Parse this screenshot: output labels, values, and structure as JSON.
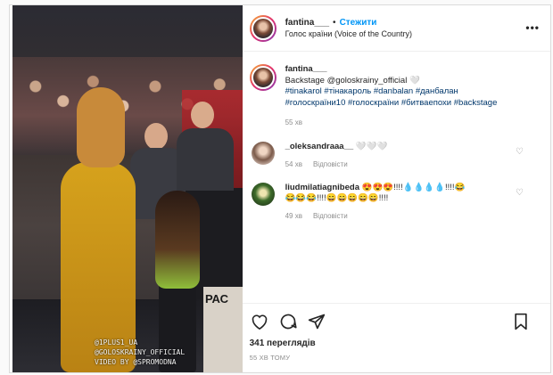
{
  "post": {
    "media": {
      "watermark_lines": [
        "@1PLUS1_UA",
        "@GOLOSKRAINY_OFFICIAL",
        "VIDEO BY @SPROMODNA"
      ],
      "sign_text": "РАС"
    },
    "header": {
      "username": "fantina___",
      "separator": "•",
      "follow_label": "Стежити",
      "location": "Голос країни (Voice of the Country)",
      "more_icon": "more-icon"
    },
    "caption": {
      "username": "fantina___",
      "text": "Backstage @goloskrainy_official 🤍",
      "hashtags": "#tinakarol #тінакароль #danbalan #данбалан #голоскраїни10 #голоскраїни #битваепохи #backstage",
      "time": "55 хв"
    },
    "comments": [
      {
        "username": "_oleksandraaa__",
        "text": "🤍🤍🤍",
        "time": "54 хв",
        "reply_label": "Відповісти"
      },
      {
        "username": "liudmilatiagnibeda",
        "text": "😍😍😍!!!!💧💧💧💧!!!!😂😂😂😂!!!!😄😄😄😄😄!!!!",
        "time": "49 хв",
        "reply_label": "Відповісти"
      }
    ],
    "actions": {
      "likes": "341 переглядів",
      "timestamp": "55 ХВ ТОМУ"
    }
  }
}
